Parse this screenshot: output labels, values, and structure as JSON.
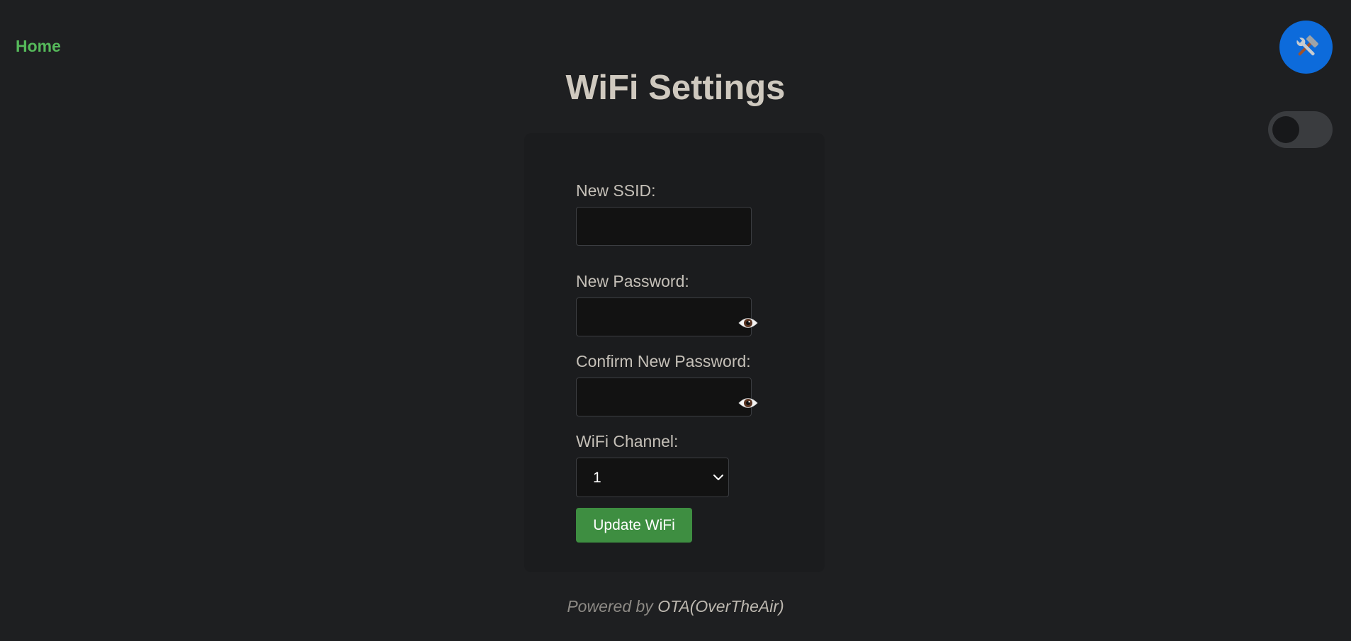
{
  "nav": {
    "home_label": "Home"
  },
  "header": {
    "title": "WiFi Settings",
    "tools_icon": "tools-icon",
    "theme_toggle_state": "off"
  },
  "form": {
    "ssid": {
      "label": "New SSID:",
      "value": "",
      "placeholder": ""
    },
    "password": {
      "label": "New Password:",
      "value": "",
      "placeholder": "",
      "reveal_icon": "eye-icon"
    },
    "confirm_password": {
      "label": "Confirm New Password:",
      "value": "",
      "placeholder": "",
      "reveal_icon": "eye-icon"
    },
    "channel": {
      "label": "WiFi Channel:",
      "selected": "1",
      "icon": "chevron-down-icon"
    },
    "submit_label": "Update WiFi"
  },
  "footer": {
    "prefix": "Powered by ",
    "brand": "OTA(OverTheAir)"
  },
  "colors": {
    "background": "#1e1f21",
    "card": "#1b1c1e",
    "accent_green": "#3e8e41",
    "link_green": "#55b85a",
    "tools_blue": "#0d6bdb"
  }
}
